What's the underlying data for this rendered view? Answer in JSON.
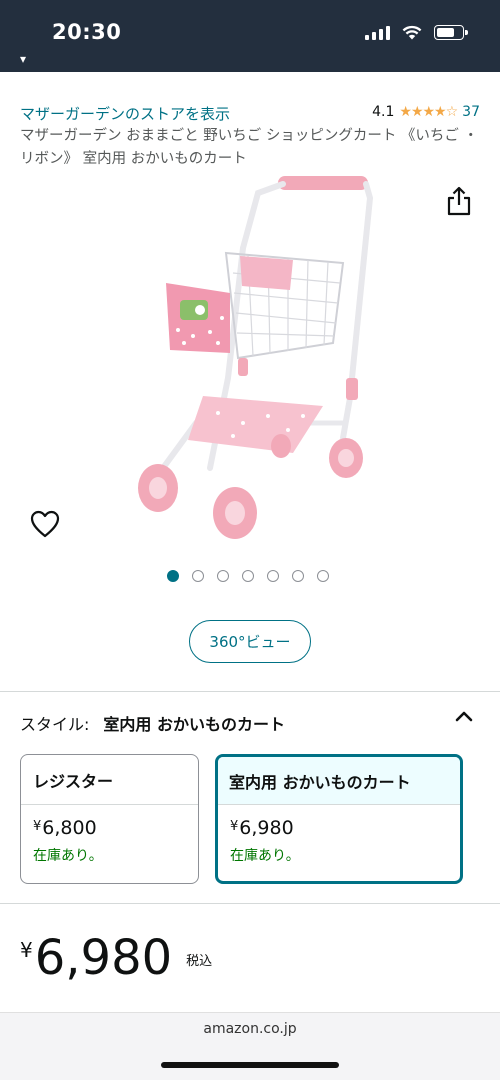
{
  "status_bar": {
    "time": "20:30"
  },
  "header": {
    "store_link": "マザーガーデンのストアを表示",
    "rating_value": "4.1",
    "rating_stars": "★★★★☆",
    "rating_count": "37",
    "title": "マザーガーデン おままごと 野いちご ショッピングカート 《いちご ・ リボン》 室内用 おかいものカート"
  },
  "gallery": {
    "image_count": 7,
    "active_index": 0,
    "view360_label": "360°ビュー"
  },
  "style_section": {
    "label": "スタイル:",
    "selected_value": "室内用 おかいものカート",
    "options": [
      {
        "name": "レジスター",
        "yen": "¥",
        "price": "6,800",
        "stock": "在庫あり。"
      },
      {
        "name": "室内用 おかいものカート",
        "yen": "¥",
        "price": "6,980",
        "stock": "在庫あり。"
      }
    ]
  },
  "price": {
    "yen": "¥",
    "amount": "6,980",
    "tax_label": "税込"
  },
  "browser": {
    "url": "amazon.co.jp"
  },
  "colors": {
    "link": "#007185",
    "star": "#f3a847",
    "stock": "#007600",
    "header_bg": "#232f3e"
  }
}
